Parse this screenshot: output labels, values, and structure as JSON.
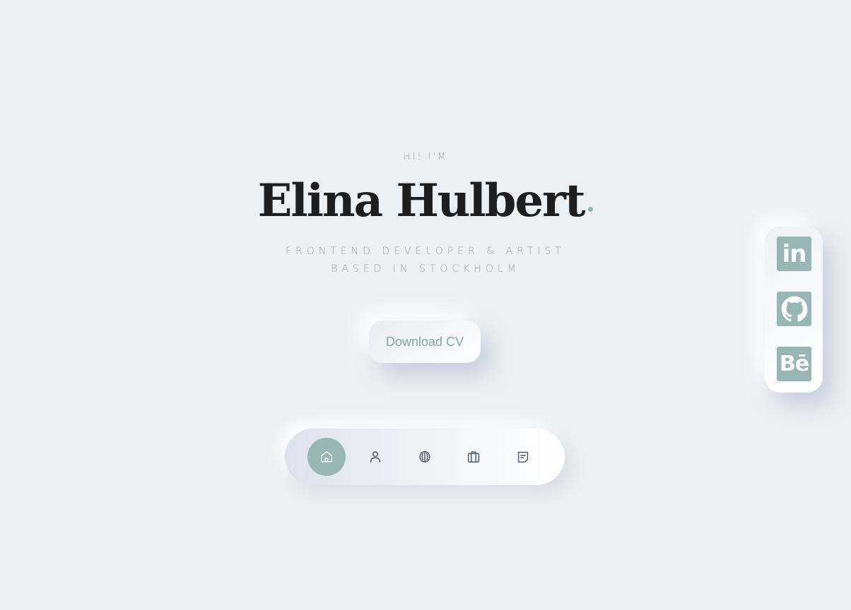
{
  "hero": {
    "greeting": "HI! I'M",
    "name": "Elina Hulbert",
    "tagline_line1": "FRONTEND DEVELOPER & ARTIST",
    "tagline_line2": "BASED IN STOCKHOLM"
  },
  "cta": {
    "download_label": "Download CV"
  },
  "nav": {
    "items": [
      {
        "icon": "home-icon",
        "active": true
      },
      {
        "icon": "user-icon",
        "active": false
      },
      {
        "icon": "brain-icon",
        "active": false
      },
      {
        "icon": "briefcase-icon",
        "active": false
      },
      {
        "icon": "message-icon",
        "active": false
      }
    ]
  },
  "social": {
    "items": [
      {
        "icon": "linkedin-icon",
        "label": "in"
      },
      {
        "icon": "github-icon"
      },
      {
        "icon": "behance-icon",
        "label": "Bē"
      }
    ]
  },
  "colors": {
    "background": "#ecf0f3",
    "accent": "#97b6b4",
    "text_dark": "#1e1e1e",
    "text_muted": "#9aa3aa"
  }
}
